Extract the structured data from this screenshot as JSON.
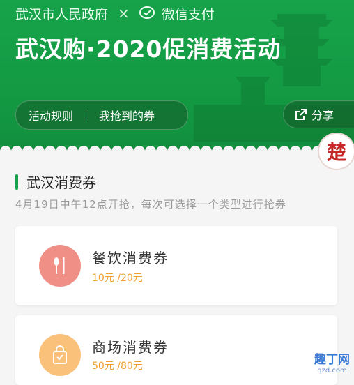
{
  "header": {
    "gov_label": "武汉市人民政府",
    "cross": "×",
    "wechat_pay_label": "微信支付"
  },
  "banner": {
    "title": "武汉购·2020促消费活动",
    "rules_label": "活动规则",
    "my_coupons_label": "我抢到的券",
    "share_label": "分享",
    "stamp_char": "楚"
  },
  "section": {
    "title": "武汉消费券",
    "subtitle": "4月19日中午12点开抢，每次可选择一个类型进行抢券"
  },
  "coupons": [
    {
      "name": "餐饮消费券",
      "amount": "10元 /20元",
      "color": "#f08f86",
      "icon": "fork-knife-icon"
    },
    {
      "name": "商场消费券",
      "amount": "50元 /80元",
      "color": "#f9c17a",
      "icon": "shopping-bag-icon"
    }
  ],
  "watermark": {
    "main": "趣丁网",
    "sub": "qzd.com"
  },
  "colors": {
    "brand_green": "#16a34a",
    "amount_orange": "#f0a030"
  }
}
